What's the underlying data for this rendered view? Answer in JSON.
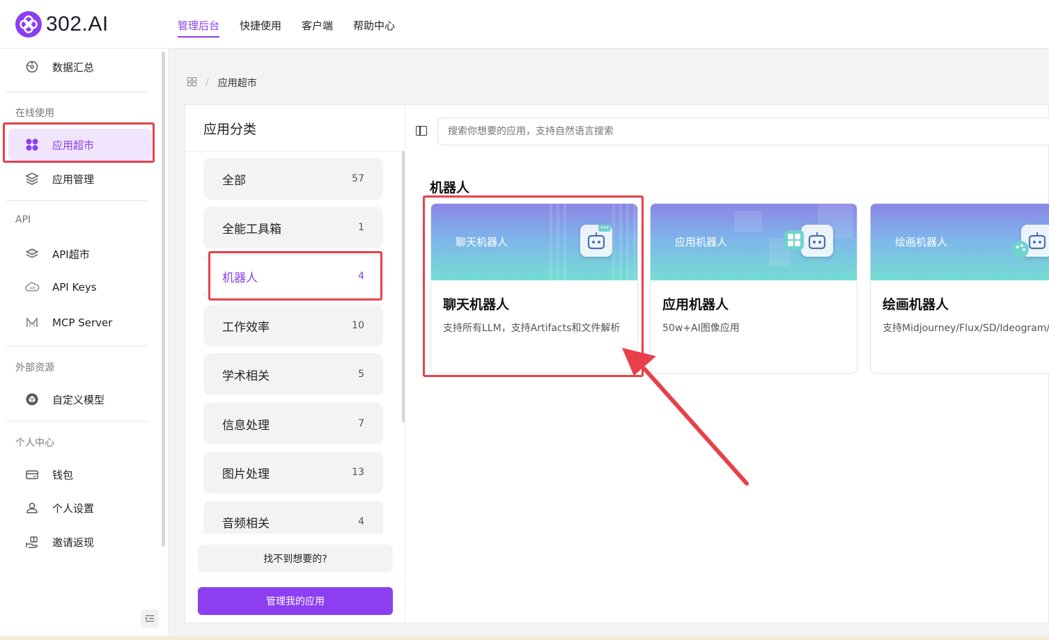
{
  "header": {
    "logo_text": "302.AI",
    "nav": [
      {
        "label": "管理后台",
        "active": true
      },
      {
        "label": "快捷使用",
        "active": false
      },
      {
        "label": "客户端",
        "active": false
      },
      {
        "label": "帮助中心",
        "active": false
      }
    ]
  },
  "sidebar": {
    "dashboard": "数据汇总",
    "sections": {
      "online": "在线使用",
      "api": "API",
      "external": "外部资源",
      "personal": "个人中心"
    },
    "items": {
      "app_store": "应用超市",
      "app_manage": "应用管理",
      "api_store": "API超市",
      "api_keys": "API Keys",
      "mcp_server": "MCP Server",
      "custom_model": "自定义模型",
      "wallet": "钱包",
      "settings": "个人设置",
      "invite": "邀请返现"
    }
  },
  "breadcrumb": {
    "current": "应用超市",
    "separator": "/"
  },
  "categories": {
    "title": "应用分类",
    "items": [
      {
        "label": "全部",
        "count": "57"
      },
      {
        "label": "全能工具箱",
        "count": "1"
      },
      {
        "label": "机器人",
        "count": "4",
        "selected": true
      },
      {
        "label": "工作效率",
        "count": "10"
      },
      {
        "label": "学术相关",
        "count": "5"
      },
      {
        "label": "信息处理",
        "count": "7"
      },
      {
        "label": "图片处理",
        "count": "13"
      },
      {
        "label": "音频相关",
        "count": "4"
      }
    ],
    "find_button": "找不到想要的?",
    "manage_button": "管理我的应用"
  },
  "main": {
    "search_placeholder": "搜索你想要的应用，支持自然语言搜索",
    "section_title": "机器人",
    "cards": [
      {
        "banner": "聊天机器人",
        "title": "聊天机器人",
        "desc": "支持所有LLM，支持Artifacts和文件解析"
      },
      {
        "banner": "应用机器人",
        "title": "应用机器人",
        "desc": "50w+AI图像应用"
      },
      {
        "banner": "绘画机器人",
        "title": "绘画机器人",
        "desc": "支持Midjourney/Flux/SD/Ideogram/R"
      }
    ]
  },
  "colors": {
    "accent": "#8b3ff0",
    "annotation": "#e8404a"
  }
}
